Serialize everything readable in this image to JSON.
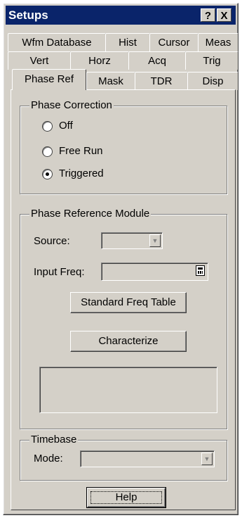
{
  "window": {
    "title": "Setups",
    "help_glyph": "?",
    "close_glyph": "X"
  },
  "tabs": {
    "row1": [
      "Wfm Database",
      "Hist",
      "Cursor",
      "Meas"
    ],
    "row2": [
      "Vert",
      "Horz",
      "Acq",
      "Trig"
    ],
    "row3": [
      "Phase Ref",
      "Mask",
      "TDR",
      "Disp"
    ],
    "active": "Phase Ref"
  },
  "phase_correction": {
    "title": "Phase Correction",
    "options": [
      "Off",
      "Free Run",
      "Triggered"
    ],
    "selected": "Triggered"
  },
  "phase_reference_module": {
    "title": "Phase Reference Module",
    "source_label": "Source:",
    "source_value": "",
    "input_freq_label": "Input Freq:",
    "input_freq_value": "",
    "standard_freq_button": "Standard Freq Table",
    "characterize_button": "Characterize",
    "status_text": ""
  },
  "timebase": {
    "title": "Timebase",
    "mode_label": "Mode:",
    "mode_value": ""
  },
  "help_button": "Help",
  "icons": {
    "dropdown": "chevron-down-icon",
    "keypad": "keypad-icon"
  }
}
